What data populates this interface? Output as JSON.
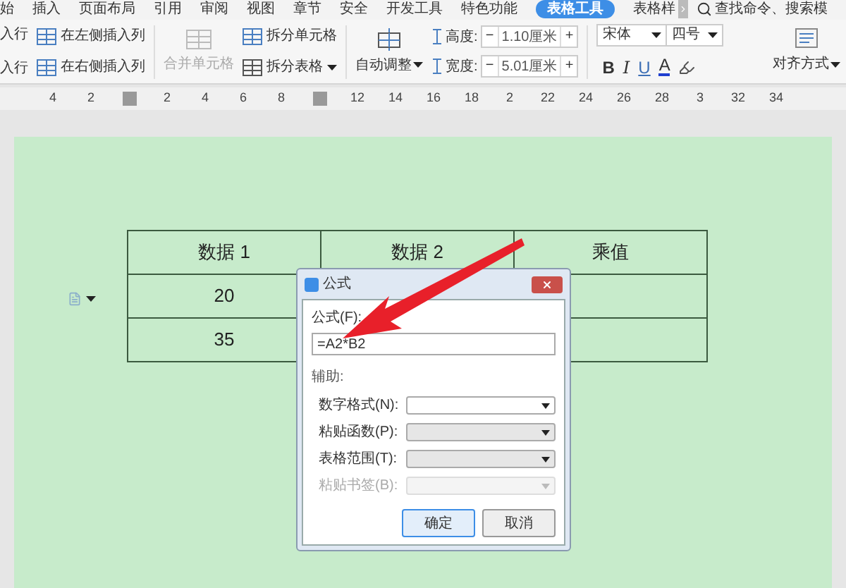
{
  "menu": {
    "tabs": [
      {
        "label": "始",
        "selected": false
      },
      {
        "label": "插入",
        "selected": false
      },
      {
        "label": "页面布局",
        "selected": false
      },
      {
        "label": "引用",
        "selected": false
      },
      {
        "label": "审阅",
        "selected": false
      },
      {
        "label": "视图",
        "selected": false
      },
      {
        "label": "章节",
        "selected": false
      },
      {
        "label": "安全",
        "selected": false
      },
      {
        "label": "开发工具",
        "selected": false
      },
      {
        "label": "特色功能",
        "selected": false
      },
      {
        "label": "表格工具",
        "selected": true
      },
      {
        "label": "表格样",
        "selected": false
      }
    ],
    "search": {
      "placeholder": "查找命令、搜索模"
    }
  },
  "ribbon": {
    "insert_rows": [
      "入行",
      "入行"
    ],
    "insert_columns": [
      "在左侧插入列",
      "在右侧插入列"
    ],
    "merge": {
      "label": "合并单元格",
      "disabled": true
    },
    "split_cell": "拆分单元格",
    "split_table": "拆分表格",
    "autofit": "自动调整",
    "height": {
      "label": "高度:",
      "value": "1.10厘米",
      "decrement": "−",
      "increment": "+"
    },
    "width": {
      "label": "宽度:",
      "value": "5.01厘米",
      "decrement": "−",
      "increment": "+"
    },
    "font": "宋体",
    "font_size": "四号",
    "format_buttons": [
      {
        "kind": "bold",
        "text": "B"
      },
      {
        "kind": "italic",
        "text": "I"
      },
      {
        "kind": "underline",
        "text": "U"
      },
      {
        "kind": "color",
        "text": "A"
      }
    ],
    "align": "对齐方式"
  },
  "ruler": [
    {
      "kind": "number",
      "text": "4"
    },
    {
      "kind": "number",
      "text": "2"
    },
    {
      "kind": "handle"
    },
    {
      "kind": "number",
      "text": "2"
    },
    {
      "kind": "number",
      "text": "4"
    },
    {
      "kind": "number",
      "text": "6"
    },
    {
      "kind": "number",
      "text": "8"
    },
    {
      "kind": "handle"
    },
    {
      "kind": "number",
      "text": "12"
    },
    {
      "kind": "number",
      "text": "14"
    },
    {
      "kind": "number",
      "text": "16"
    },
    {
      "kind": "number",
      "text": "18"
    },
    {
      "kind": "number",
      "text": "2"
    },
    {
      "kind": "number",
      "text": "22"
    },
    {
      "kind": "number",
      "text": "24"
    },
    {
      "kind": "number",
      "text": "26"
    },
    {
      "kind": "number",
      "text": "28"
    },
    {
      "kind": "number",
      "text": "3"
    },
    {
      "kind": "number",
      "text": "32"
    },
    {
      "kind": "number",
      "text": "34"
    }
  ],
  "table": {
    "rows": [
      [
        "数据 1",
        "数据 2",
        "乘值"
      ],
      [
        "20",
        "",
        ""
      ],
      [
        "35",
        "",
        ""
      ]
    ]
  },
  "dialog": {
    "title": "公式",
    "formula_label": "公式(F):",
    "formula_value": "=A2*B2",
    "helper_label": "辅助:",
    "fields": [
      {
        "label": "数字格式(N):",
        "disabled": false,
        "kind": "white"
      },
      {
        "label": "粘贴函数(P):",
        "disabled": false,
        "kind": "gray"
      },
      {
        "label": "表格范围(T):",
        "disabled": false,
        "kind": "gray"
      },
      {
        "label": "粘贴书签(B):",
        "disabled": true,
        "kind": "gray"
      }
    ],
    "buttons": [
      {
        "label": "确定",
        "selected": true
      },
      {
        "label": "取消",
        "selected": false
      }
    ]
  }
}
